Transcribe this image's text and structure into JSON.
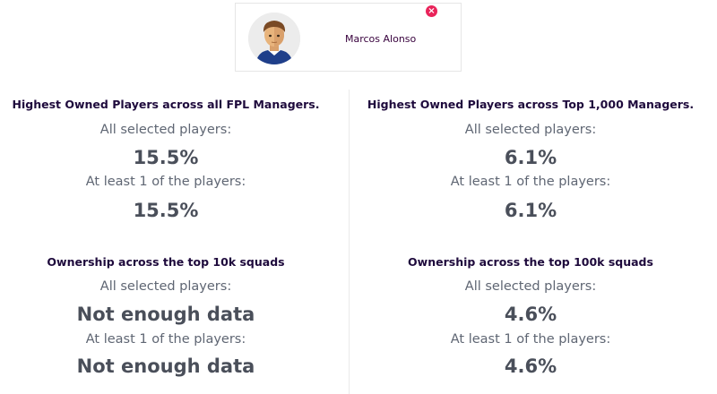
{
  "player": {
    "name": "Marcos Alonso",
    "remove_glyph": "×"
  },
  "panels": {
    "all_fpl": {
      "title": "Highest Owned Players across all FPL Managers.",
      "selected_label": "All selected players:",
      "selected_value": "15.5%",
      "atleast_label": "At least 1 of the players:",
      "atleast_value": "15.5%"
    },
    "top_1000": {
      "title": "Highest Owned Players across Top 1,000 Managers.",
      "selected_label": "All selected players:",
      "selected_value": "6.1%",
      "atleast_label": "At least 1 of the players:",
      "atleast_value": "6.1%"
    },
    "top_10k": {
      "title": "Ownership across the top 10k squads",
      "selected_label": "All selected players:",
      "selected_value": "Not enough data",
      "atleast_label": "At least 1 of the players:",
      "atleast_value": "Not enough data"
    },
    "top_100k": {
      "title": "Ownership across the top 100k squads",
      "selected_label": "All selected players:",
      "selected_value": "4.6%",
      "atleast_label": "At least 1 of the players:",
      "atleast_value": "4.6%"
    }
  },
  "colors": {
    "accent": "#e9235a",
    "title": "#1e0a3c",
    "label": "#5f6673",
    "value": "#4a4f5a"
  }
}
